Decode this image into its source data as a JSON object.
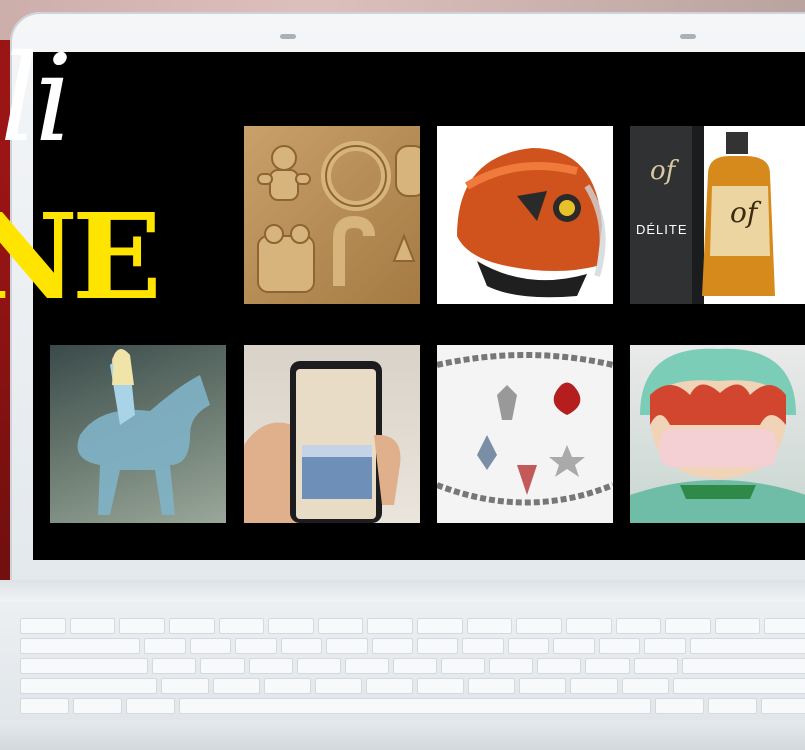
{
  "headline": {
    "script_text": "li",
    "block_text": "NE"
  },
  "colors": {
    "headline_yellow": "#ffe400",
    "screen_black": "#000000",
    "background_red": "#7a1010"
  },
  "tiles": [
    {
      "name": "chocolate-mold",
      "desc_icon": "gingerbread-mold-icon"
    },
    {
      "name": "motorcycle-helmet",
      "desc_icon": "helmet-icon"
    },
    {
      "name": "liquor-bottle",
      "box_brand": "of",
      "box_label": "DÉLITE",
      "bottle_brand": "of"
    },
    {
      "name": "toy-horse-figure",
      "desc_icon": "horse-icon"
    },
    {
      "name": "smartphone-in-hand",
      "desc_icon": "phone-icon"
    },
    {
      "name": "charm-bracelet",
      "desc_icon": "bracelet-icon"
    },
    {
      "name": "rag-doll-with-mask",
      "desc_icon": "doll-icon"
    }
  ]
}
